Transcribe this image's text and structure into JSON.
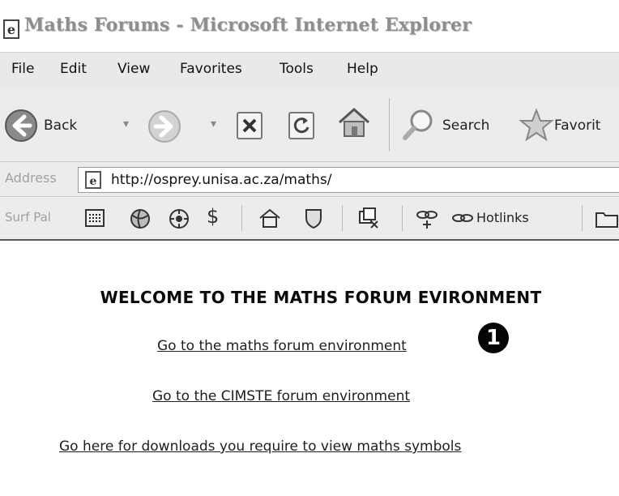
{
  "window": {
    "title": "Maths Forums - Microsoft Internet Explorer"
  },
  "menubar": {
    "items": [
      "File",
      "Edit",
      "View",
      "Favorites",
      "Tools",
      "Help"
    ]
  },
  "toolbar": {
    "back_label": "Back",
    "search_label": "Search",
    "favorites_label": "Favorit"
  },
  "addressbar": {
    "label": "Address",
    "url": "http://osprey.unisa.ac.za/maths/"
  },
  "linksbar": {
    "label": "Surf Pal",
    "hotlinks_label": "Hotlinks"
  },
  "page": {
    "heading": "WELCOME TO THE MATHS FORUM EVIRONMENT",
    "links": [
      "Go to the maths forum environment",
      "Go to the CIMSTE forum environment",
      "Go here for downloads you require to view maths symbols"
    ],
    "callout_number": "1"
  }
}
